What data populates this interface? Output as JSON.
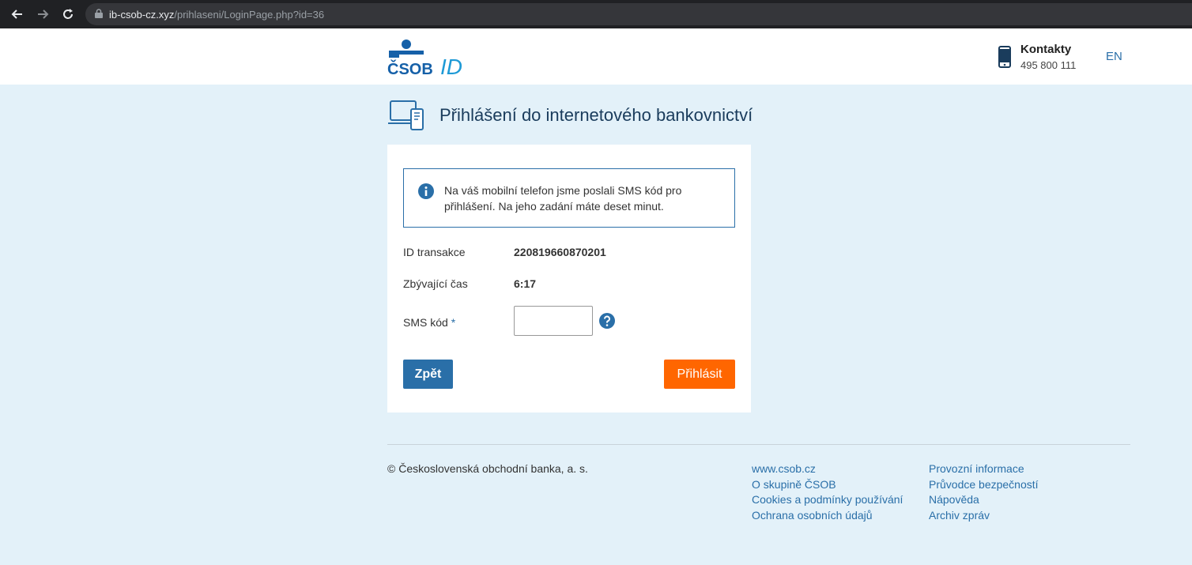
{
  "browser": {
    "url_host": "ib-csob-cz.xyz",
    "url_path": "/prihlaseni/LoginPage.php?id=36"
  },
  "header": {
    "logo_text": "ČSOB",
    "logo_suffix": "ID",
    "contacts_title": "Kontakty",
    "contacts_phone": "495 800 111",
    "lang": "EN"
  },
  "page": {
    "title": "Přihlášení do internetového bankovnictví"
  },
  "form": {
    "info": "Na váš mobilní telefon jsme poslali SMS kód pro přihlášení. Na jeho zadání máte deset minut.",
    "transaction_label": "ID transakce",
    "transaction_value": "220819660870201",
    "time_label": "Zbývající čas",
    "time_value": "6:17",
    "sms_label": "SMS kód",
    "sms_required": "*",
    "sms_value": "",
    "back_label": "Zpět",
    "login_label": "Přihlásit"
  },
  "footer": {
    "copyright": "© Československá obchodní banka, a. s.",
    "links_col1": [
      "www.csob.cz",
      "O skupině ČSOB",
      "Cookies a podmínky používání",
      "Ochrana osobních údajů"
    ],
    "links_col2": [
      "Provozní informace",
      "Průvodce bezpečností",
      "Nápověda",
      "Archiv zpráv"
    ]
  },
  "colors": {
    "accent": "#2a6fa8",
    "login_button": "#ff6600",
    "page_background": "#e3f1f9",
    "logo_blue": "#1560a8",
    "logo_id": "#1e9ad6"
  },
  "icons": {
    "back": "arrow-left-icon",
    "forward": "arrow-right-icon",
    "reload": "reload-icon",
    "lock": "lock-icon",
    "phone": "mobile-phone-icon",
    "devices": "devices-icon",
    "info": "info-icon",
    "help": "question-icon"
  }
}
